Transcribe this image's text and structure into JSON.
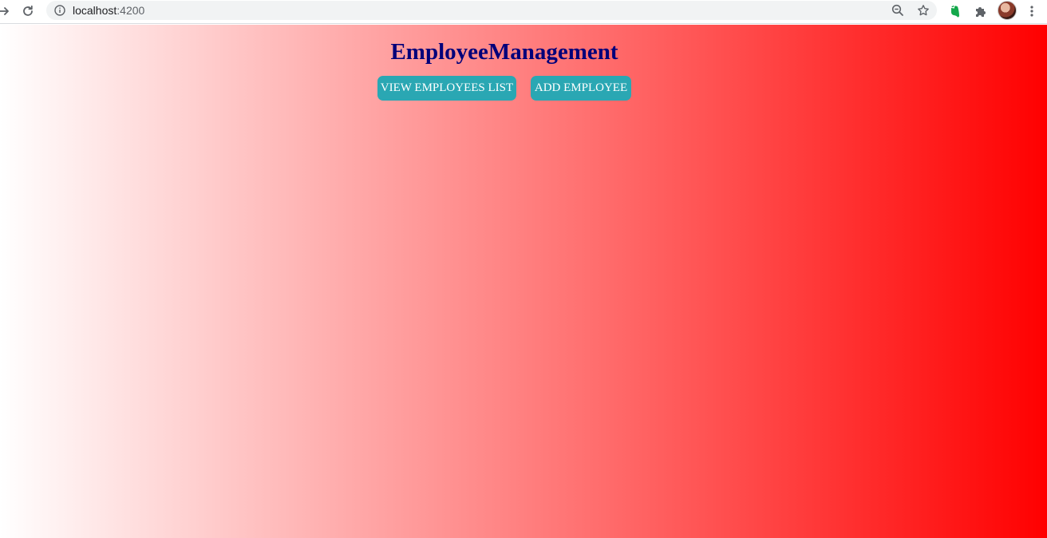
{
  "browser": {
    "url_host": "localhost",
    "url_port": ":4200"
  },
  "app": {
    "title": "EmployeeManagement",
    "nav": {
      "view_list_label": "VIEW EMPLOYEES LIST",
      "add_label": "ADD EMPLOYEE"
    }
  },
  "colors": {
    "title": "#00007a",
    "button_bg": "#2aa7b3",
    "gradient_start": "#ffffff",
    "gradient_end": "#ff0000"
  },
  "icons": {
    "back": "back-arrow-icon",
    "reload": "reload-icon",
    "site_info": "info-icon",
    "zoom": "zoom-out-icon",
    "bookmark": "star-icon",
    "evernote": "evernote-icon",
    "extensions": "puzzle-icon",
    "menu": "kebab-menu-icon"
  }
}
